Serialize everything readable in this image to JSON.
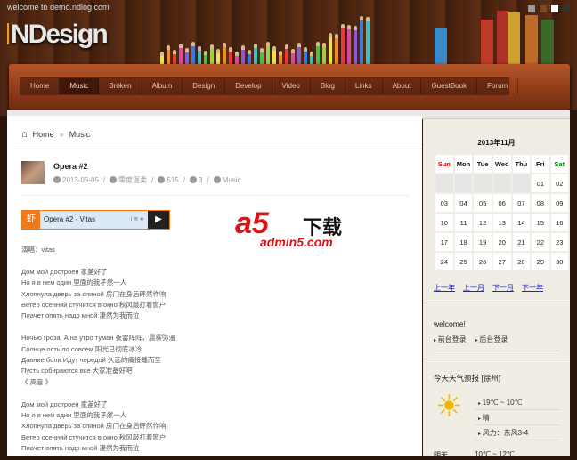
{
  "header": {
    "welcome": "welcome to demo.ndlog.com",
    "logo": "NDesign",
    "swatches": [
      "#9a9a9a",
      "#7a4a22",
      "#ffffff",
      "#333333"
    ]
  },
  "nav": {
    "items": [
      "Home",
      "Music",
      "Broken",
      "Album",
      "Design",
      "Develop",
      "Video",
      "Blog",
      "Links",
      "About",
      "GuestBook",
      "Forum"
    ],
    "active": "Music"
  },
  "breadcrumb": {
    "home": "Home",
    "sep": "»",
    "current": "Music"
  },
  "post": {
    "title": "Opera #2",
    "date": "2013-05-05",
    "author": "零度温柔",
    "views": "515",
    "comments": "3",
    "category": "Music"
  },
  "player": {
    "badge": "虾",
    "title": "Opera #2 - Vitas",
    "tools": "i ✉ ★",
    "play": "▶"
  },
  "watermark": {
    "brand": "a5",
    "cn": "下载",
    "domain": "admin5.com"
  },
  "lyrics": {
    "singer": "演唱：vitas",
    "stanzas": [
      [
        "Дом мой достроен 家盖好了",
        "Но я в нем один 里面的我孑然一人",
        "Хлопнула дверь за спиной 房门在身后砰然作响",
        "Ветер осенний стучится в окно 秋风敲打着窗户",
        "Плачет опять надо мной 凄然为我而泣"
      ],
      [
        "Ночью гроза, А на утро туман 夜雷阵阵，晨雾弥漫",
        "Солнце остыло совсем 阳光已彻底冰冷",
        "Давние боли Идут чередой 久远的痛接踵而至",
        "Пусть собираются все 大家准备好吧",
        "《 高音 》"
      ],
      [
        "Дом мой достроен 家盖好了",
        "Но я в нем один 里面的我孑然一人",
        "Хлопнула дверь за спиной 房门在身后砰然作响",
        "Ветер осенний стучится в окно 秋风敲打着窗户",
        "Плачет опять надо мной 凄然为我而泣"
      ]
    ]
  },
  "calendar": {
    "title": "2013年11月",
    "days": [
      "Sun",
      "Mon",
      "Tue",
      "Wed",
      "Thu",
      "Fri",
      "Sat"
    ],
    "weeks": [
      [
        "",
        "",
        "",
        "",
        "",
        "01",
        "02"
      ],
      [
        "03",
        "04",
        "05",
        "06",
        "07",
        "08",
        "09"
      ],
      [
        "10",
        "11",
        "12",
        "13",
        "14",
        "15",
        "16"
      ],
      [
        "17",
        "18",
        "19",
        "20",
        "21",
        "22",
        "23"
      ],
      [
        "24",
        "25",
        "26",
        "27",
        "28",
        "29",
        "30"
      ]
    ],
    "nav": [
      "上一年",
      "上一月",
      "下一月",
      "下一年"
    ]
  },
  "welcome": {
    "title": "welcome!",
    "links": [
      "前台登录",
      "后台登录"
    ]
  },
  "weather": {
    "title": "今天天气预报 [徐州]",
    "items": [
      "19℃ ~ 10℃",
      "晴",
      "风力：东风3-4"
    ],
    "tomorrow_label": "明天",
    "tomorrow_temp": "10℃ ~ 12℃"
  }
}
